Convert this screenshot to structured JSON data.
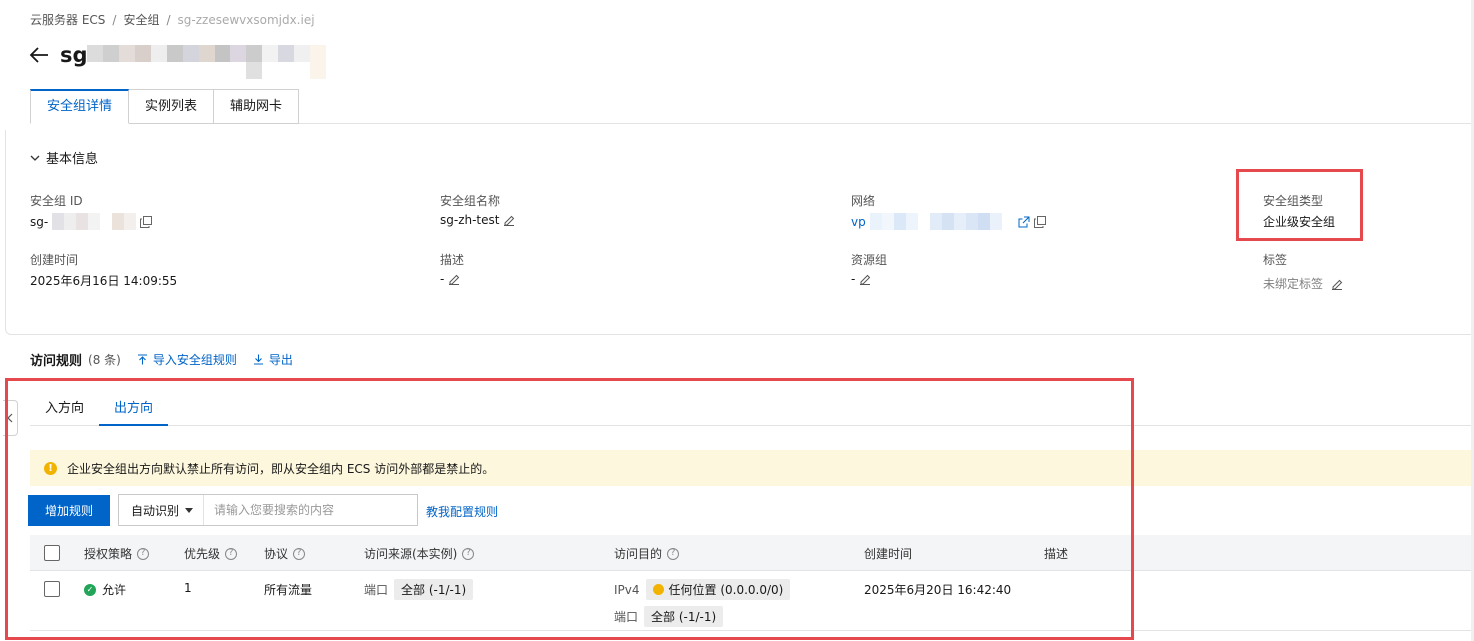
{
  "breadcrumb": {
    "items": [
      "云服务器 ECS",
      "安全组",
      "sg-zzesewvxsomjdx.iej"
    ],
    "separator": "/"
  },
  "page": {
    "title": "sg"
  },
  "tabs": [
    "安全组详情",
    "实例列表",
    "辅助网卡"
  ],
  "basic_info": {
    "section_title": "基本信息",
    "fields": {
      "id_label": "安全组 ID",
      "id_value": "sg-",
      "name_label": "安全组名称",
      "name_value": "sg-zh-test",
      "network_label": "网络",
      "network_value": "vp",
      "type_label": "安全组类型",
      "type_value": "企业级安全组",
      "created_label": "创建时间",
      "created_value": "2025年6月16日 14:09:55",
      "desc_label": "描述",
      "desc_value": "-",
      "rg_label": "资源组",
      "rg_value": "-",
      "tags_label": "标签",
      "tags_value": "未绑定标签"
    }
  },
  "rules": {
    "title": "访问规则",
    "count": "(8 条)",
    "import_label": "导入安全组规则",
    "export_label": "导出",
    "direction_tabs": [
      "入方向",
      "出方向"
    ],
    "active_direction": "出方向",
    "notice": "企业安全组出方向默认禁止所有访问，即从安全组内 ECS 访问外部都是禁止的。",
    "add_button": "增加规则",
    "search_select": "自动识别",
    "search_placeholder": "请输入您要搜索的内容",
    "help_link": "教我配置规则",
    "columns": [
      "授权策略",
      "优先级",
      "协议",
      "访问来源(本实例)",
      "访问目的",
      "创建时间",
      "描述"
    ],
    "rows": [
      {
        "policy": "允许",
        "priority": "1",
        "protocol": "所有流量",
        "source_port_label": "端口",
        "source_port": "全部 (-1/-1)",
        "dest_type": "IPv4",
        "dest_value": "任何位置 (0.0.0.0/0)",
        "dest_port_label": "端口",
        "dest_port": "全部 (-1/-1)",
        "created": "2025年6月20日 16:42:40",
        "description": ""
      }
    ]
  },
  "colors": {
    "primary": "#0064c8",
    "highlight_box": "#e5484d",
    "notice_bg": "#fdf7dd",
    "warning": "#f2b300",
    "success": "#23a559"
  },
  "icons": [
    "back-arrow-icon",
    "chevron-down-icon",
    "copy-icon",
    "edit-icon",
    "external-link-icon",
    "import-icon",
    "export-icon",
    "warning-icon",
    "question-icon",
    "check-circle-icon",
    "chevron-left-icon",
    "caret-down-icon"
  ]
}
